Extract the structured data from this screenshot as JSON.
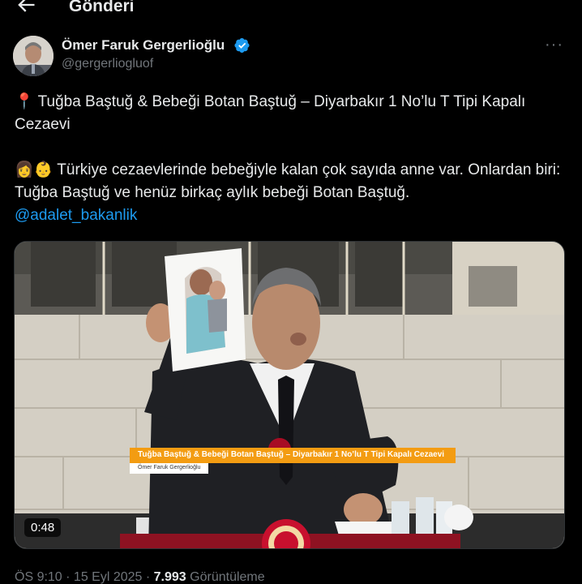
{
  "header": {
    "title": "Gönderi",
    "back_icon": "arrow-left-icon"
  },
  "author": {
    "name": "Ömer Faruk Gergerlioğlu",
    "handle": "@gergerliogluof",
    "verified": true,
    "verified_color": "#1d9bf0"
  },
  "tweet": {
    "line1_emoji": "📍",
    "line1": "Tuğba Baştuğ & Bebeği Botan Baştuğ – Diyarbakır 1 No’lu T Tipi Kapalı Cezaevi",
    "line2_emoji": "👩👶",
    "line2": "Türkiye cezaevlerinde bebeğiyle kalan çok sayıda anne var. Onlardan biri: Tuğba Baştuğ ve henüz birkaç aylık bebeği Botan Baştuğ.",
    "mention": "@adalet_bakanlik"
  },
  "video": {
    "duration": "0:48",
    "lower_third_title": "Tuğba Baştuğ & Bebeği Botan Baştuğ – Diyarbakır 1 No’lu T Tipi Kapalı Cezaevi",
    "lower_third_name": "Ömer Faruk Gergerlioğlu"
  },
  "meta": {
    "time": "ÖS 9:10",
    "sep1": " · ",
    "date": "15 Eyl 2025",
    "sep2": " · ",
    "views": "7.993",
    "views_label": " Görüntüleme"
  },
  "colors": {
    "background": "#000000",
    "text": "#e7e9ea",
    "muted": "#71767b",
    "link": "#1d9bf0",
    "lower_third": "#f39c12"
  }
}
